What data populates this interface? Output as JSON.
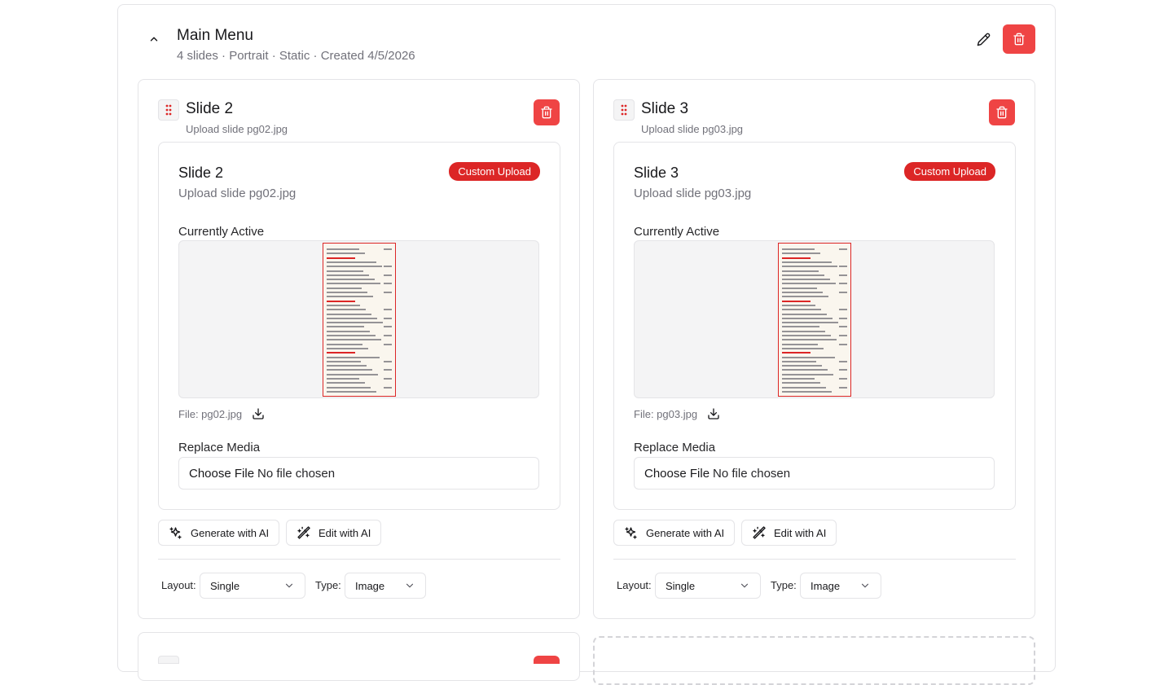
{
  "menu": {
    "title": "Main Menu",
    "subtitle": "4 slides · Portrait · Static · Created 4/5/2026"
  },
  "slides": [
    {
      "title": "Slide 2",
      "upload_text": "Upload slide pg02.jpg",
      "inner_title": "Slide 2",
      "inner_sub": "Upload slide pg02.jpg",
      "badge": "Custom Upload",
      "active_label": "Currently Active",
      "file_label": "File: pg02.jpg",
      "replace_label": "Replace Media",
      "choose_file": "Choose File",
      "no_file": "No file chosen",
      "generate_ai": "Generate with AI",
      "edit_ai": "Edit with AI",
      "layout_label": "Layout:",
      "layout_value": "Single",
      "type_label": "Type:",
      "type_value": "Image"
    },
    {
      "title": "Slide 3",
      "upload_text": "Upload slide pg03.jpg",
      "inner_title": "Slide 3",
      "inner_sub": "Upload slide pg03.jpg",
      "badge": "Custom Upload",
      "active_label": "Currently Active",
      "file_label": "File: pg03.jpg",
      "replace_label": "Replace Media",
      "choose_file": "Choose File",
      "no_file": "No file chosen",
      "generate_ai": "Generate with AI",
      "edit_ai": "Edit with AI",
      "layout_label": "Layout:",
      "layout_value": "Single",
      "type_label": "Type:",
      "type_value": "Image"
    }
  ],
  "colors": {
    "danger": "#ef4444",
    "badge": "#dc2626",
    "border": "#e4e4e7",
    "muted_text": "#71717a"
  },
  "icons": {
    "collapse": "chevron-up-icon",
    "edit": "pencil-icon",
    "delete": "trash-icon",
    "drag": "grip-vertical-icon",
    "download": "download-icon",
    "generate": "sparkles-icon",
    "edit_ai": "wand-icon",
    "dropdown": "chevron-down-icon"
  }
}
